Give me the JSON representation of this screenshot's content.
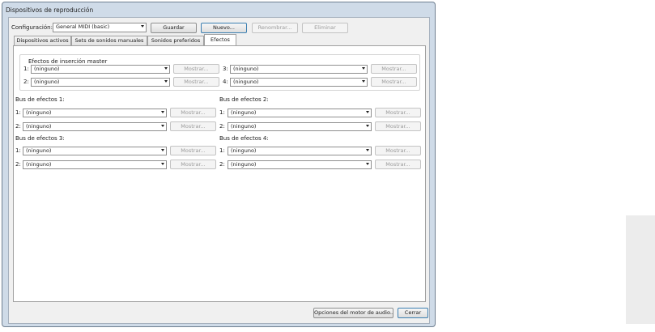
{
  "window": {
    "title": "Dispositivos de reproducción"
  },
  "toolbar": {
    "config_label": "Configuración:",
    "config_value": "General MIDI (basic)",
    "save": "Guardar",
    "new": "Nuevo...",
    "rename": "Renombrar...",
    "delete": "Eliminar"
  },
  "tabs": [
    "Dispositivos activos",
    "Sets de sonidos manuales",
    "Sonidos preferidos",
    "Efectos"
  ],
  "master": {
    "title": "Efectos de inserción master",
    "rows": [
      {
        "num": "1:",
        "value": "(ninguno)",
        "show": "Mostrar..."
      },
      {
        "num": "2:",
        "value": "(ninguno)",
        "show": "Mostrar..."
      },
      {
        "num": "3:",
        "value": "(ninguno)",
        "show": "Mostrar..."
      },
      {
        "num": "4:",
        "value": "(ninguno)",
        "show": "Mostrar..."
      }
    ]
  },
  "buses": [
    {
      "title": "Bus de efectos 1:",
      "rows": [
        {
          "num": "1:",
          "value": "(ninguno)",
          "show": "Mostrar..."
        },
        {
          "num": "2:",
          "value": "(ninguno)",
          "show": "Mostrar..."
        }
      ]
    },
    {
      "title": "Bus de efectos 2:",
      "rows": [
        {
          "num": "1:",
          "value": "(ninguno)",
          "show": "Mostrar..."
        },
        {
          "num": "2:",
          "value": "(ninguno)",
          "show": "Mostrar..."
        }
      ]
    },
    {
      "title": "Bus de efectos 3:",
      "rows": [
        {
          "num": "1:",
          "value": "(ninguno)",
          "show": "Mostrar..."
        },
        {
          "num": "2:",
          "value": "(ninguno)",
          "show": "Mostrar..."
        }
      ]
    },
    {
      "title": "Bus de efectos 4:",
      "rows": [
        {
          "num": "1:",
          "value": "(ninguno)",
          "show": "Mostrar..."
        },
        {
          "num": "2:",
          "value": "(ninguno)",
          "show": "Mostrar..."
        }
      ]
    }
  ],
  "footer": {
    "audio_options": "Opciones del motor de audio...",
    "close": "Cerrar"
  }
}
